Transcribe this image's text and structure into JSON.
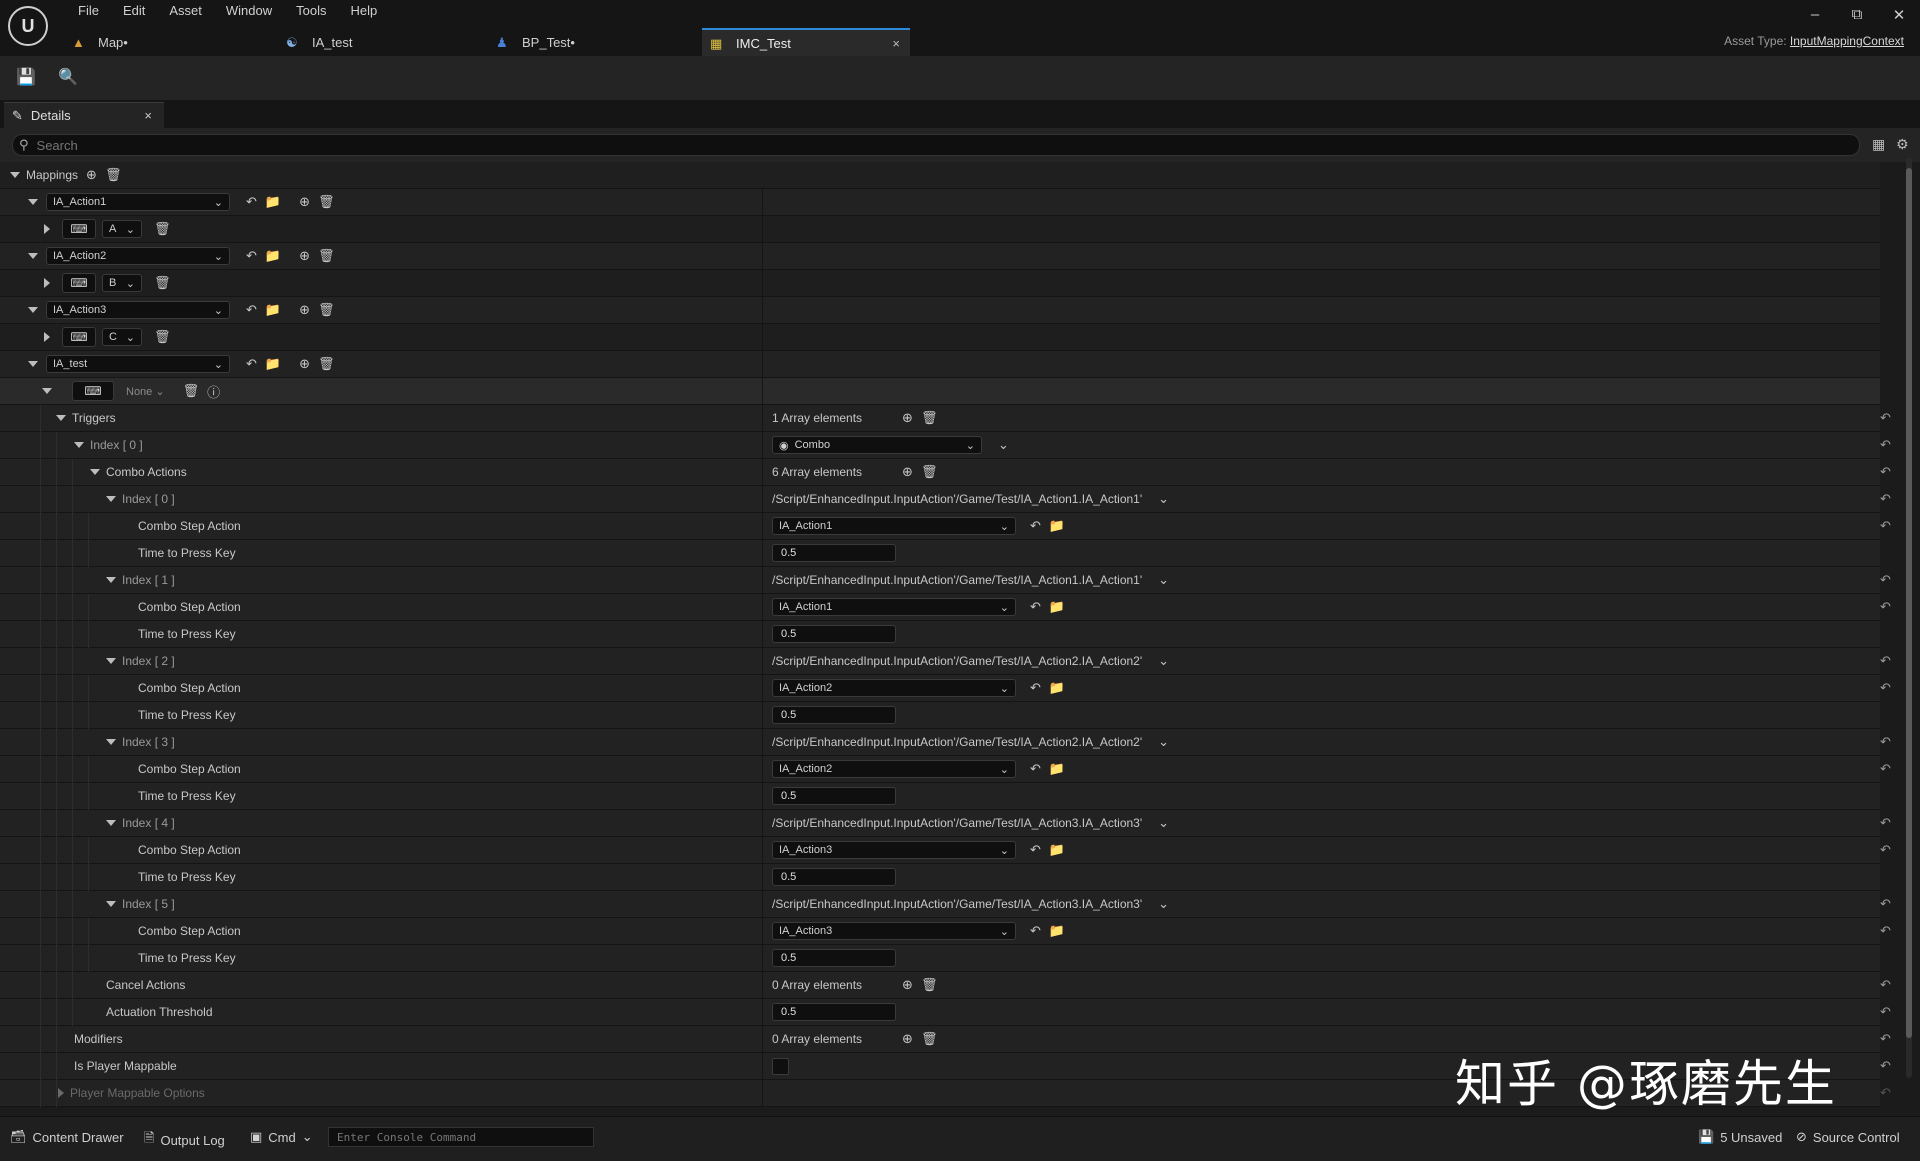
{
  "menu": [
    "File",
    "Edit",
    "Asset",
    "Window",
    "Tools",
    "Help"
  ],
  "tabs": [
    {
      "label": "Map•",
      "icon": "map-icon"
    },
    {
      "label": "IA_test",
      "icon": "input-action-icon"
    },
    {
      "label": "BP_Test•",
      "icon": "blueprint-icon"
    },
    {
      "label": "IMC_Test",
      "icon": "input-mapping-icon",
      "active": true
    }
  ],
  "asset_type": {
    "label": "Asset Type:",
    "value": "InputMappingContext"
  },
  "panel": {
    "tab_label": "Details",
    "search_placeholder": "Search"
  },
  "mappings_label": "Mappings",
  "mappings": [
    {
      "action": "IA_Action1",
      "key": "A"
    },
    {
      "action": "IA_Action2",
      "key": "B"
    },
    {
      "action": "IA_Action3",
      "key": "C"
    },
    {
      "action": "IA_test",
      "key": "None"
    }
  ],
  "triggers": {
    "label": "Triggers",
    "count": "1 Array elements",
    "index0_label": "Index [ 0 ]",
    "index0_value": "Combo",
    "combo_actions_label": "Combo Actions",
    "combo_actions_count": "6 Array elements",
    "items": [
      {
        "index": "Index [ 0 ]",
        "path": "/Script/EnhancedInput.InputAction'/Game/Test/IA_Action1.IA_Action1'",
        "action": "IA_Action1",
        "time": "0.5"
      },
      {
        "index": "Index [ 1 ]",
        "path": "/Script/EnhancedInput.InputAction'/Game/Test/IA_Action1.IA_Action1'",
        "action": "IA_Action1",
        "time": "0.5"
      },
      {
        "index": "Index [ 2 ]",
        "path": "/Script/EnhancedInput.InputAction'/Game/Test/IA_Action2.IA_Action2'",
        "action": "IA_Action2",
        "time": "0.5"
      },
      {
        "index": "Index [ 3 ]",
        "path": "/Script/EnhancedInput.InputAction'/Game/Test/IA_Action2.IA_Action2'",
        "action": "IA_Action2",
        "time": "0.5"
      },
      {
        "index": "Index [ 4 ]",
        "path": "/Script/EnhancedInput.InputAction'/Game/Test/IA_Action3.IA_Action3'",
        "action": "IA_Action3",
        "time": "0.5"
      },
      {
        "index": "Index [ 5 ]",
        "path": "/Script/EnhancedInput.InputAction'/Game/Test/IA_Action3.IA_Action3'",
        "action": "IA_Action3",
        "time": "0.5"
      }
    ],
    "step_action_label": "Combo Step Action",
    "time_label": "Time to Press Key",
    "cancel_label": "Cancel Actions",
    "cancel_count": "0 Array elements",
    "threshold_label": "Actuation Threshold",
    "threshold_value": "0.5"
  },
  "modifiers": {
    "label": "Modifiers",
    "count": "0 Array elements"
  },
  "player_mappable": {
    "label": "Is Player Mappable"
  },
  "player_mappable_options": {
    "label": "Player Mappable Options"
  },
  "status": {
    "content_drawer": "Content Drawer",
    "output_log": "Output Log",
    "cmd": "Cmd",
    "console_placeholder": "Enter Console Command",
    "unsaved": "5 Unsaved",
    "source_control": "Source Control"
  },
  "watermark": "知乎 @琢磨先生"
}
